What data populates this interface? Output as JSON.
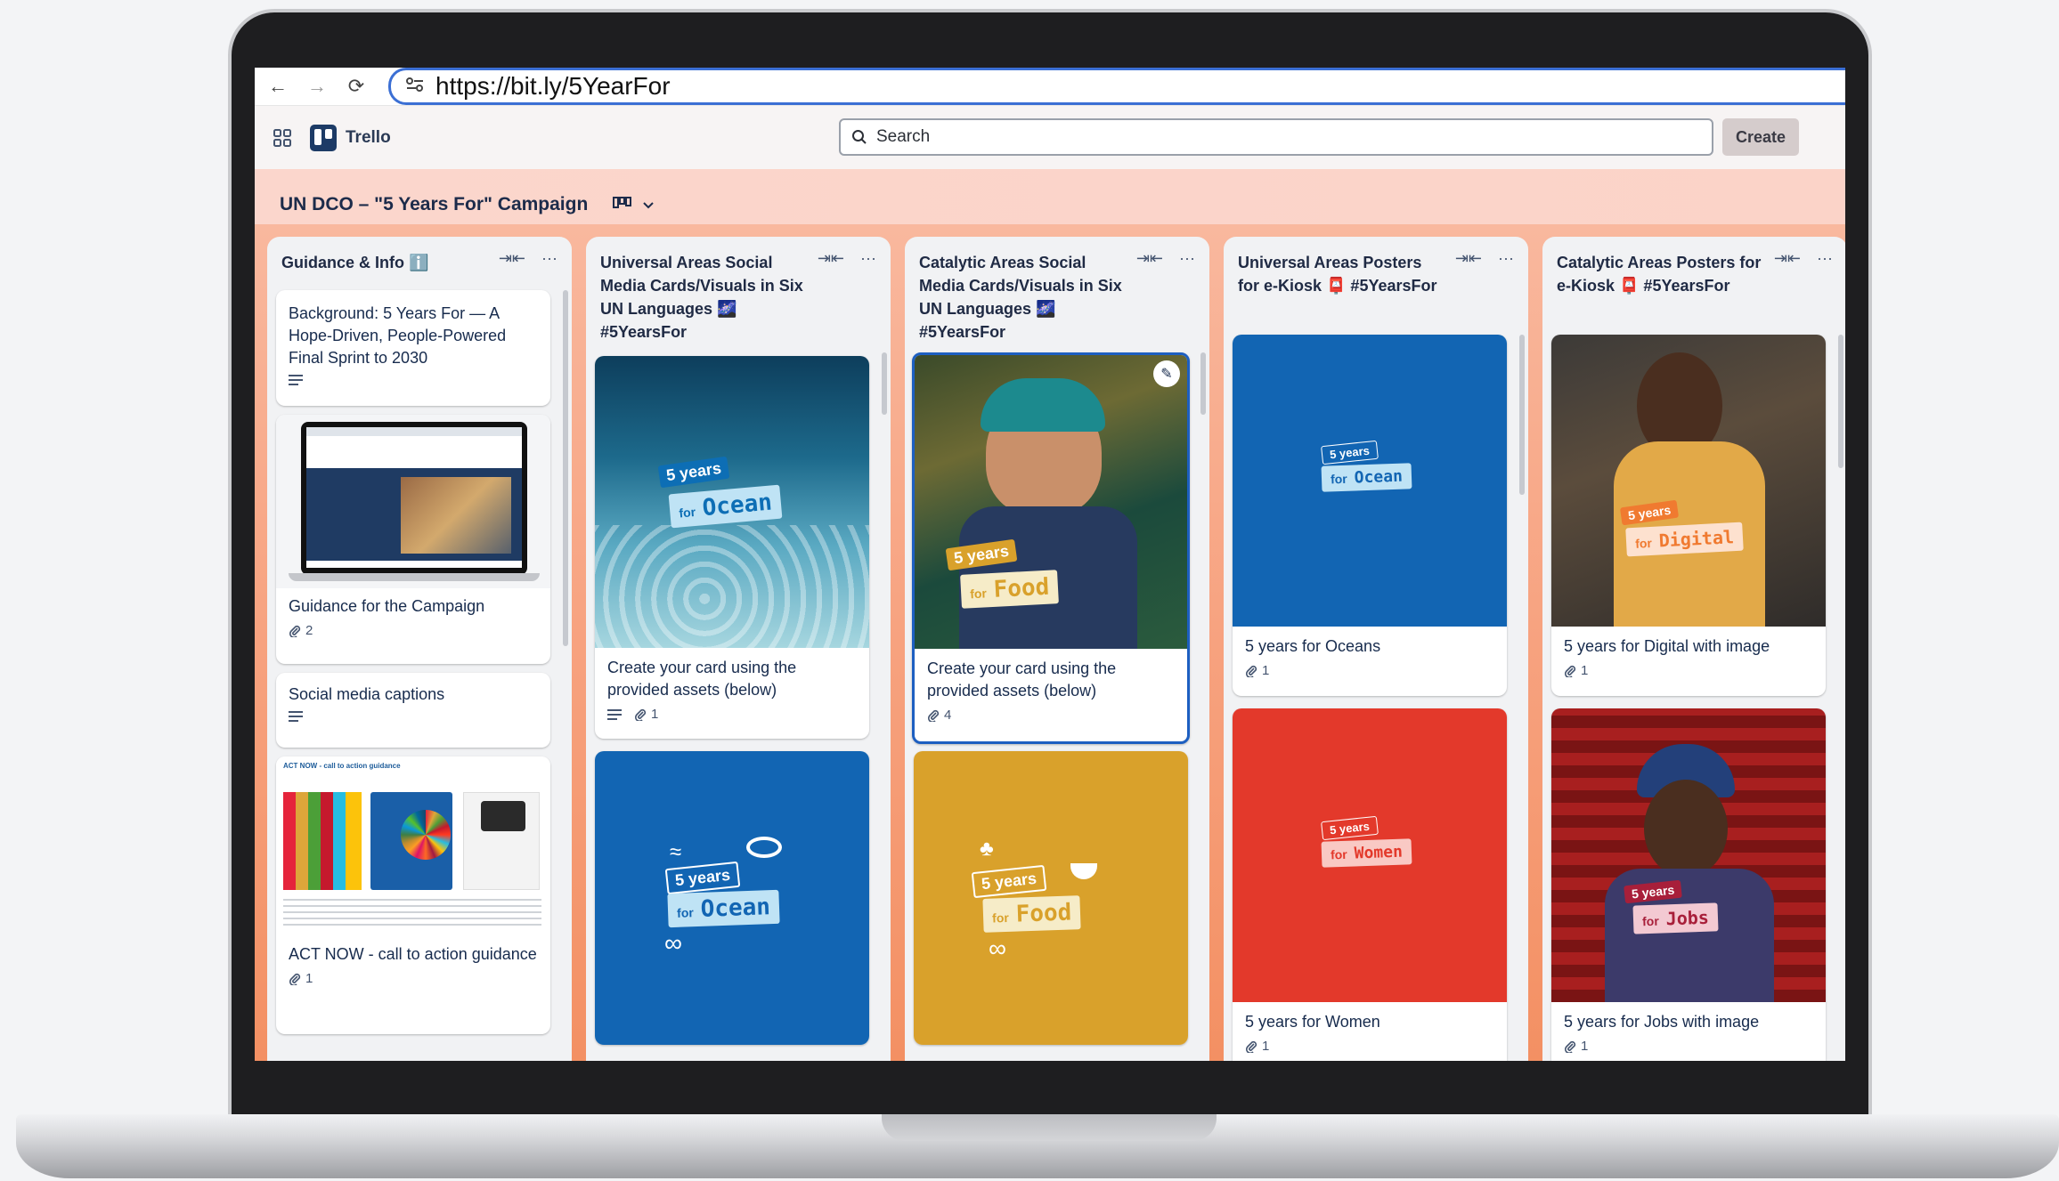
{
  "browser": {
    "url": "https://bit.ly/5YearFor"
  },
  "app": {
    "name": "Trello",
    "search_placeholder": "Search",
    "create_label": "Create"
  },
  "board": {
    "title": "UN DCO – \"5 Years For\" Campaign"
  },
  "lists": [
    {
      "title": "Guidance & Info ℹ️",
      "cards": [
        {
          "title": "Background: 5 Years For — A Hope-Driven, People-Powered Final Sprint to 2030"
        },
        {
          "title": "Guidance for the Campaign",
          "attachments": "2"
        },
        {
          "title": "Social media captions"
        },
        {
          "title": "ACT NOW - call to action guidance",
          "attachments": "1",
          "cover_heading": "ACT NOW - call to action guidance"
        }
      ]
    },
    {
      "title": "Universal Areas Social Media Cards/Visuals in Six UN Languages 🌌 #5YearsFor",
      "cards": [
        {
          "title": "Create your card using the provided assets (below)",
          "attachments": "1",
          "sticker": {
            "years": "5 years",
            "for": "for",
            "word": "Ocean"
          }
        },
        {
          "sticker": {
            "years": "5 years",
            "for": "for",
            "word": "Ocean"
          }
        }
      ]
    },
    {
      "title": "Catalytic Areas Social Media Cards/Visuals in Six UN Languages 🌌 #5YearsFor",
      "cards": [
        {
          "title": "Create your card using the provided assets (below)",
          "attachments": "4",
          "sticker": {
            "years": "5 years",
            "for": "for",
            "word": "Food"
          }
        },
        {
          "sticker": {
            "years": "5 years",
            "for": "for",
            "word": "Food"
          }
        }
      ]
    },
    {
      "title": "Universal Areas Posters for e-Kiosk 📮 #5YearsFor",
      "cards": [
        {
          "title": "5 years for Oceans",
          "attachments": "1",
          "sticker": {
            "years": "5 years",
            "for": "for",
            "word": "Ocean"
          }
        },
        {
          "title": "5 years for Women",
          "attachments": "1",
          "sticker": {
            "years": "5 years",
            "for": "for",
            "word": "Women"
          }
        }
      ]
    },
    {
      "title": "Catalytic Areas Posters for e-Kiosk 📮 #5YearsFor",
      "cards": [
        {
          "title": "5 years for Digital with image",
          "attachments": "1",
          "sticker": {
            "years": "5 years",
            "for": "for",
            "word": "Digital"
          }
        },
        {
          "title": "5 years for Jobs with image",
          "attachments": "1",
          "sticker": {
            "years": "5 years",
            "for": "for",
            "word": "Jobs"
          }
        }
      ]
    }
  ],
  "colors": {
    "un_blue": "#1265b3",
    "women_red": "#e3392b",
    "food_gold": "#d9a12b",
    "board_gradient": "#f7a27f"
  }
}
